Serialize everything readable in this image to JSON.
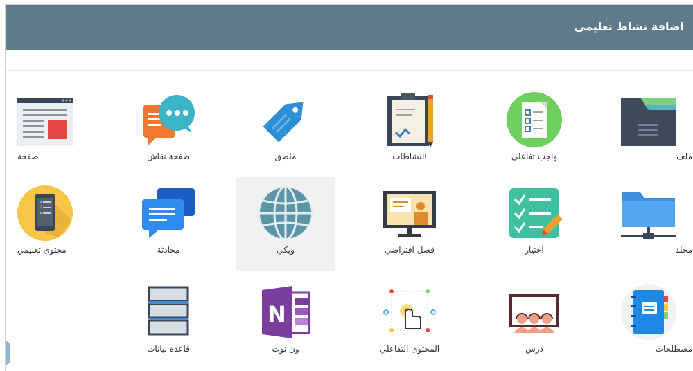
{
  "dialog": {
    "title": "اضافة نشاط تعليمي"
  },
  "activities": [
    {
      "label": "ملف",
      "icon": "folder-file-icon"
    },
    {
      "label": "واجب تفاعلي",
      "icon": "checklist-doc-icon"
    },
    {
      "label": "النشاطات",
      "icon": "clipboard-icon"
    },
    {
      "label": "ملصق",
      "icon": "tag-icon"
    },
    {
      "label": "صفحة نقاش",
      "icon": "chat-bubbles-icon"
    },
    {
      "label": "صفحة",
      "icon": "web-page-icon"
    },
    {
      "label": "مجلد",
      "icon": "network-folder-icon"
    },
    {
      "label": "اختيار",
      "icon": "choice-checklist-icon"
    },
    {
      "label": "فصل افتراضي",
      "icon": "virtual-classroom-icon"
    },
    {
      "label": "ويكي",
      "icon": "globe-icon"
    },
    {
      "label": "محادثة",
      "icon": "chat-icon"
    },
    {
      "label": "محتوى تعليمي",
      "icon": "mobile-content-icon"
    },
    {
      "label": "مصطلحات",
      "icon": "notebook-icon"
    },
    {
      "label": "درس",
      "icon": "lesson-icon"
    },
    {
      "label": "المحتوى التفاعلي",
      "icon": "interactive-content-icon"
    },
    {
      "label": "ون نوت",
      "icon": "onenote-icon"
    },
    {
      "label": "قاعدة بيانات",
      "icon": "database-icon"
    }
  ],
  "colors": {
    "header": "#5f7b89",
    "selected": "#f1f1f1"
  }
}
